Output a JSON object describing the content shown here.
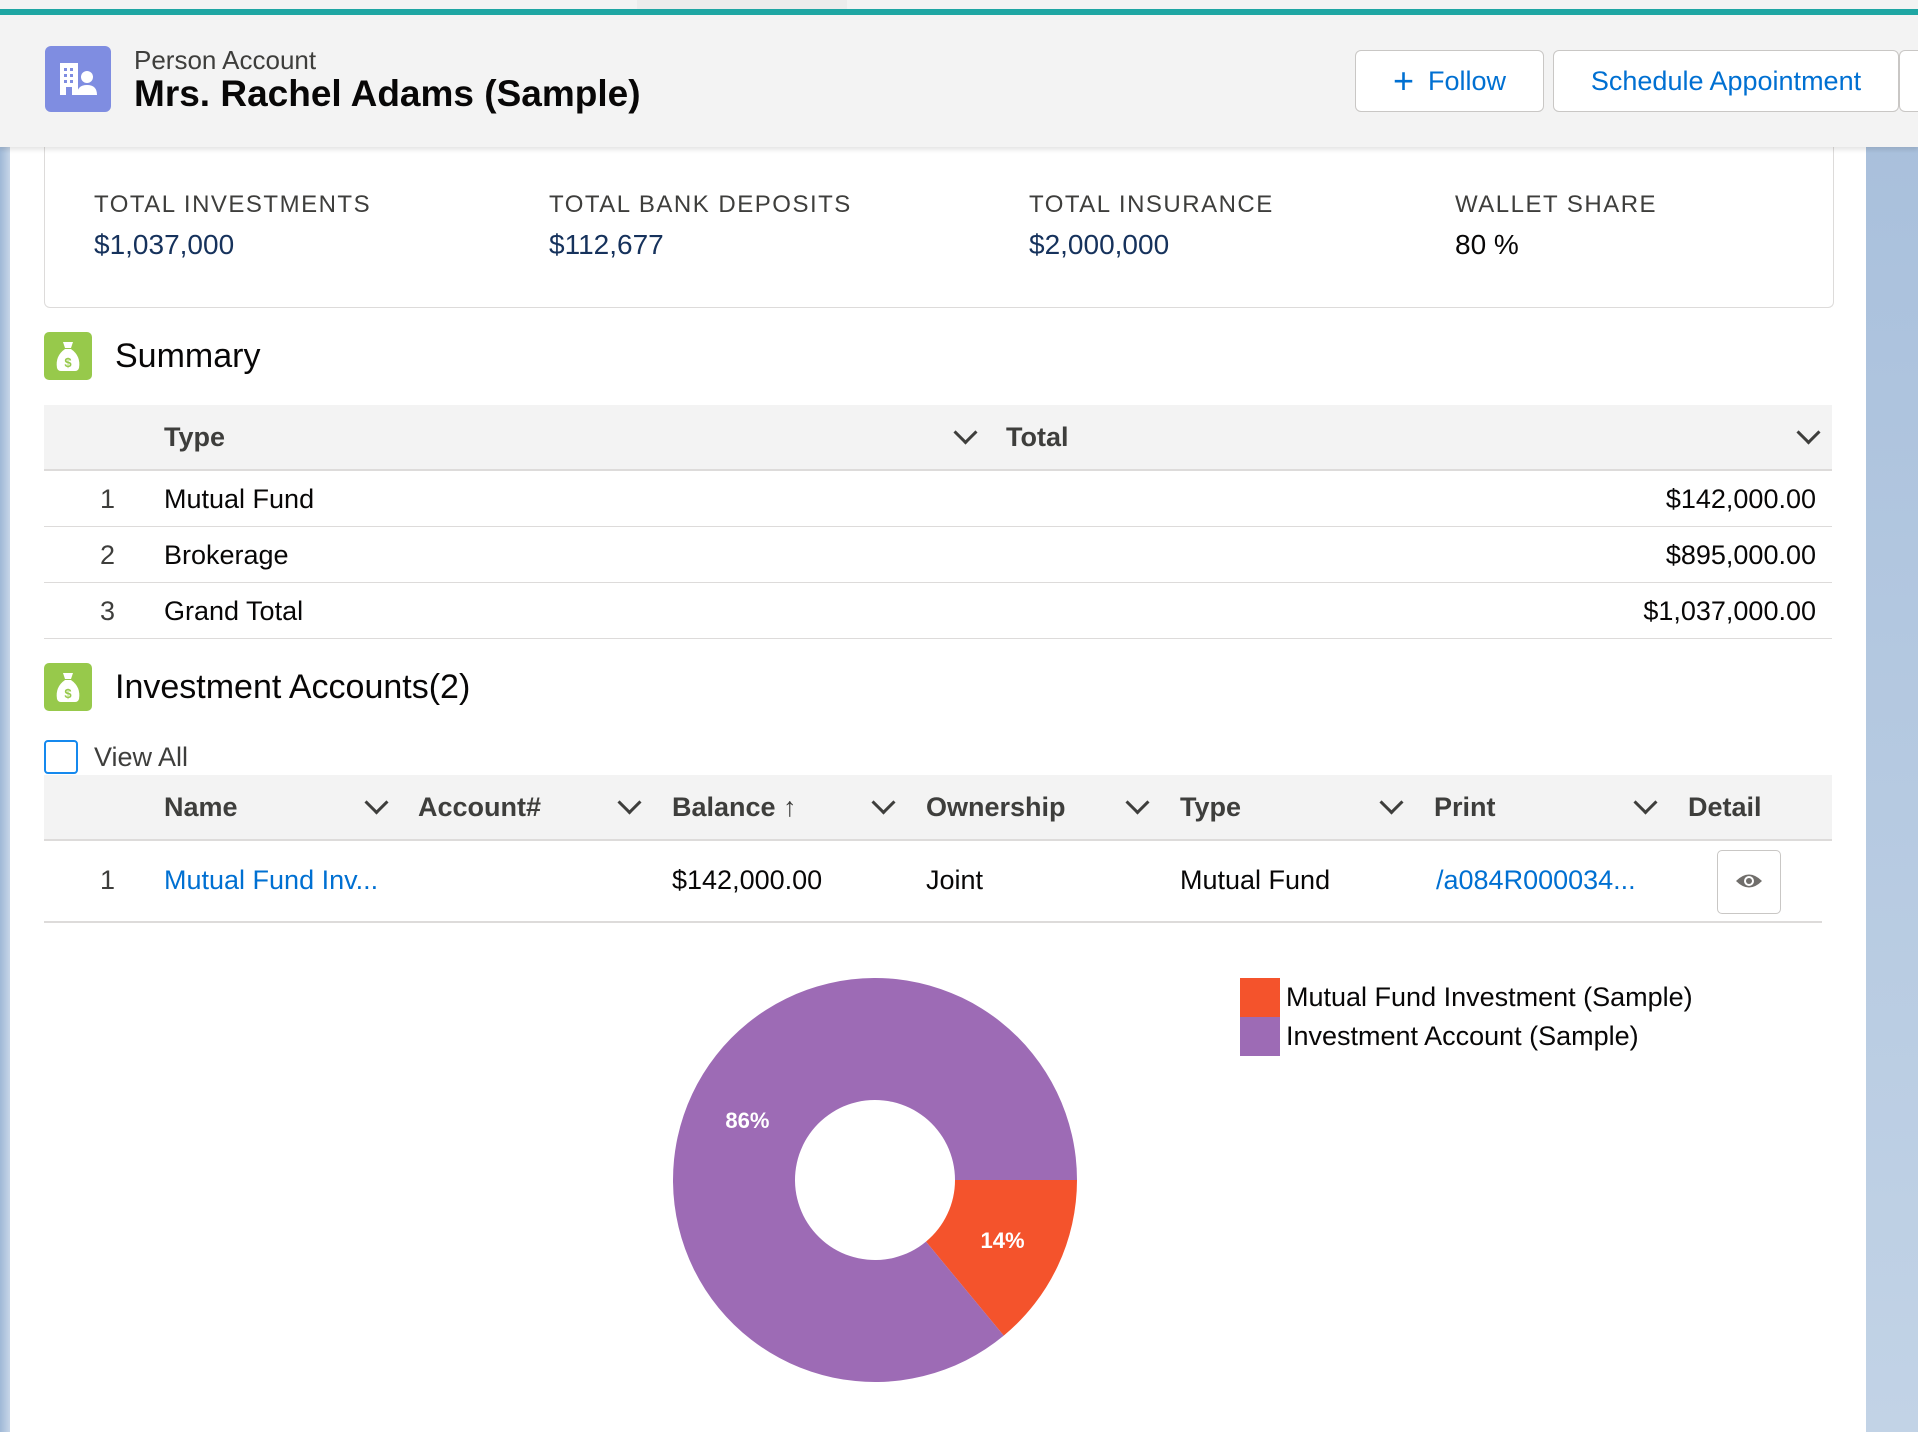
{
  "header": {
    "object_type": "Person Account",
    "record_name": "Mrs. Rachel Adams (Sample)",
    "follow_label": "Follow",
    "follow_glyph": "+",
    "schedule_label": "Schedule Appointment"
  },
  "metrics": [
    {
      "label": "TOTAL INVESTMENTS",
      "value": "$1,037,000"
    },
    {
      "label": "TOTAL BANK DEPOSITS",
      "value": "$112,677"
    },
    {
      "label": "TOTAL INSURANCE",
      "value": "$2,000,000"
    },
    {
      "label": "WALLET SHARE",
      "value": "80 %"
    }
  ],
  "summary": {
    "title": "Summary",
    "columns": [
      "Type",
      "Total"
    ],
    "rows": [
      {
        "num": "1",
        "type": "Mutual Fund",
        "total": "$142,000.00"
      },
      {
        "num": "2",
        "type": "Brokerage",
        "total": "$895,000.00"
      },
      {
        "num": "3",
        "type": "Grand Total",
        "total": "$1,037,000.00"
      }
    ]
  },
  "investment_accounts": {
    "title": "Investment Accounts(2)",
    "view_all_label": "View All",
    "view_all_checked": false,
    "columns": [
      "Name",
      "Account#",
      "Balance",
      "Ownership",
      "Type",
      "Print",
      "Detail"
    ],
    "sort_glyph": "↑",
    "rows": [
      {
        "num": "1",
        "name": "Mutual Fund Inv...",
        "account": "",
        "balance": "$142,000.00",
        "ownership": "Joint",
        "type": "Mutual Fund",
        "print": "/a084R000034..."
      }
    ]
  },
  "chart_data": {
    "type": "pie",
    "donut": true,
    "slices": [
      {
        "label": "Mutual Fund Investment (Sample)",
        "value": 14,
        "display": "14%",
        "color": "#f4532c"
      },
      {
        "label": "Investment Account (Sample)",
        "value": 86,
        "display": "86%",
        "color": "#9d6bb5"
      }
    ],
    "legend_position": "right"
  },
  "colors": {
    "accent": "#0070d2",
    "teal_stripe": "#1ea6a3",
    "account_icon": "#7f8de1",
    "section_icon": "#97c94b"
  },
  "icons": {
    "account": "person-account-icon",
    "section": "money-bag-icon",
    "detail": "eye-icon",
    "dropdown": "chevron-down-icon"
  }
}
